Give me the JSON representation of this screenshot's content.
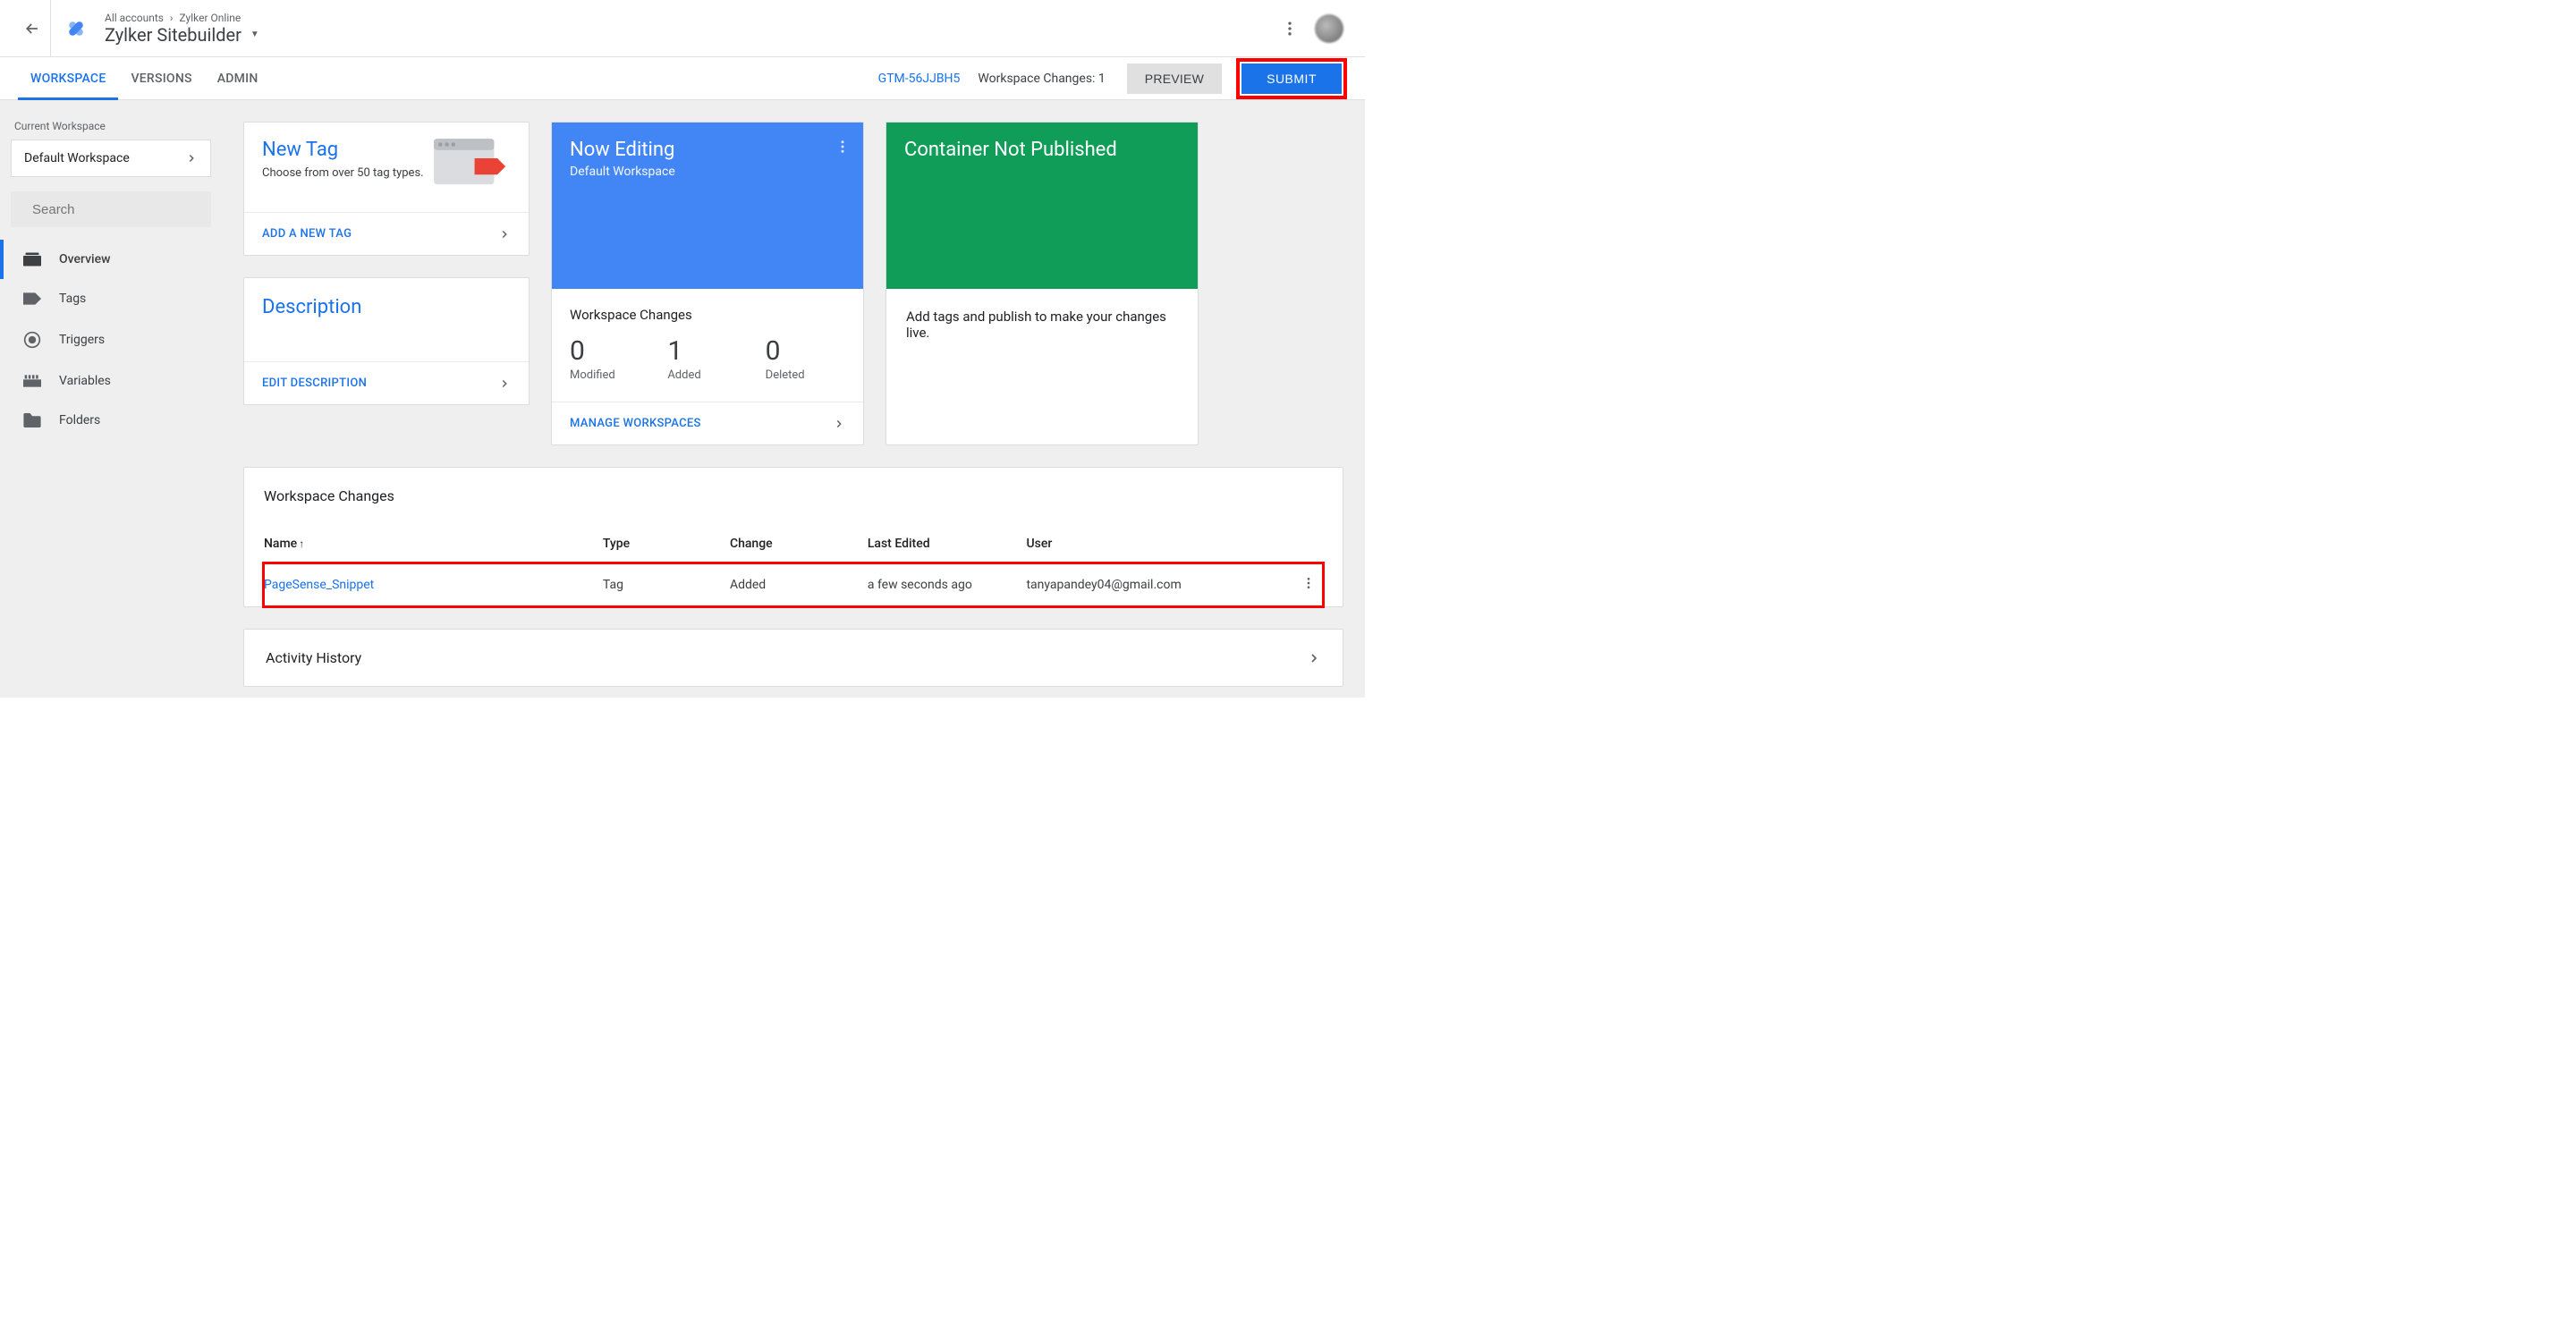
{
  "header": {
    "breadcrumb": [
      "All accounts",
      "Zylker Online"
    ],
    "title": "Zylker Sitebuilder"
  },
  "tabs": {
    "items": [
      "Workspace",
      "Versions",
      "Admin"
    ],
    "active": 0,
    "container_id": "GTM-56JJBH5",
    "workspace_changes_label": "Workspace Changes: 1",
    "preview_label": "PREVIEW",
    "submit_label": "SUBMIT"
  },
  "sidebar": {
    "current_ws_label": "Current Workspace",
    "current_ws_value": "Default Workspace",
    "search_placeholder": "Search",
    "nav": [
      "Overview",
      "Tags",
      "Triggers",
      "Variables",
      "Folders"
    ],
    "nav_active": 0
  },
  "cards": {
    "new_tag": {
      "title": "New Tag",
      "subtitle": "Choose from over 50 tag types.",
      "link": "ADD A NEW TAG"
    },
    "description": {
      "title": "Description",
      "link": "EDIT DESCRIPTION"
    },
    "editing": {
      "title": "Now Editing",
      "subtitle": "Default Workspace",
      "changes_label": "Workspace Changes",
      "stats": [
        {
          "n": "0",
          "l": "Modified"
        },
        {
          "n": "1",
          "l": "Added"
        },
        {
          "n": "0",
          "l": "Deleted"
        }
      ],
      "link": "MANAGE WORKSPACES"
    },
    "publish": {
      "title": "Container Not Published",
      "body": "Add tags and publish to make your changes live."
    }
  },
  "changes_table": {
    "title": "Workspace Changes",
    "columns": [
      "Name",
      "Type",
      "Change",
      "Last Edited",
      "User"
    ],
    "rows": [
      {
        "name": "PageSense_Snippet",
        "type": "Tag",
        "change": "Added",
        "last_edited": "a few seconds ago",
        "user": "tanyapandey04@gmail.com"
      }
    ]
  },
  "activity": {
    "title": "Activity History"
  }
}
